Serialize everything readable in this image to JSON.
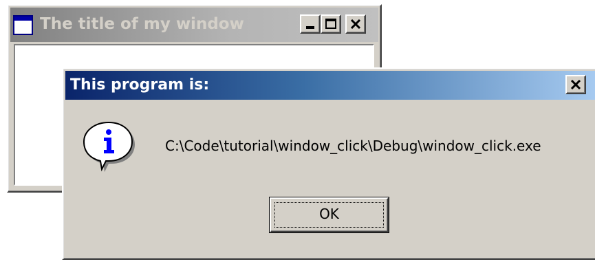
{
  "background_window": {
    "title": "The title of my window",
    "icon": "app-window-icon",
    "controls": [
      "minimize-icon",
      "maximize-icon",
      "close-icon"
    ]
  },
  "message_box": {
    "title": "This program is:",
    "icon": "information-icon",
    "message": "C:\\Code\\tutorial\\window_click\\Debug\\window_click.exe",
    "ok_label": "OK",
    "close_icon": "close-icon"
  },
  "colors": {
    "face": "#d4d0c8",
    "active_title_start": "#0a246a",
    "active_title_end": "#a6caf0",
    "inactive_title": "#808080",
    "info_blue": "#0000ff"
  }
}
